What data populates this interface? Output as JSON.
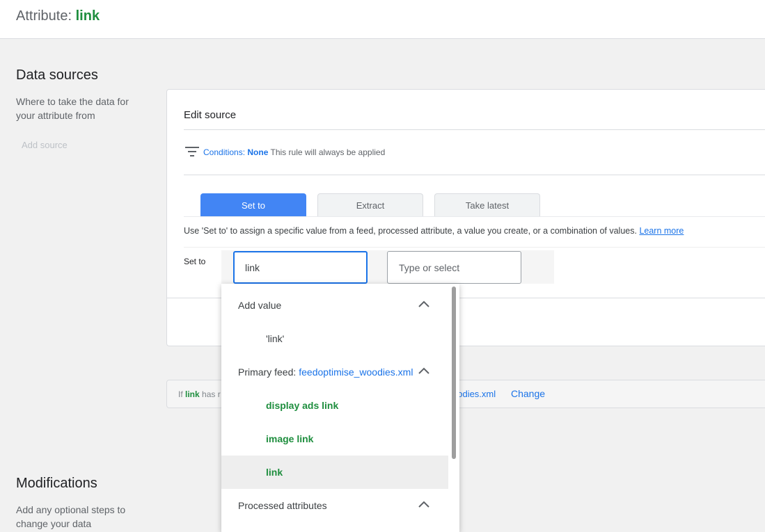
{
  "header": {
    "title_prefix": "Attribute:",
    "attr_name": "link"
  },
  "data_sources": {
    "title": "Data sources",
    "description": "Where to take the data for your attribute from",
    "add_source": "Add source"
  },
  "edit_source": {
    "title": "Edit source",
    "conditions_label": "Conditions:",
    "conditions_value": "None",
    "conditions_note": "This rule will always be applied",
    "tabs": [
      {
        "label": "Set to",
        "active": true
      },
      {
        "label": "Extract",
        "active": false
      },
      {
        "label": "Take latest",
        "active": false
      }
    ],
    "help_text": "Use 'Set to' to assign a specific value from a feed, processed attribute, a value you create, or a combination of values.",
    "learn_more": "Learn more",
    "set_to_label": "Set to",
    "input_value": "link",
    "input_placeholder": "Type or select"
  },
  "info_bar": {
    "prefix_if": "If",
    "attr": "link",
    "prefix_rest": "has r",
    "file_partial": "oodies.xml",
    "change": "Change"
  },
  "dropdown": {
    "add_value_group": "Add value",
    "add_value_item": "'link'",
    "primary_feed_label": "Primary feed:",
    "primary_feed_file": "feedoptimise_woodies.xml",
    "feed_items": [
      "display ads link",
      "image link",
      "link"
    ],
    "selected_item": "link",
    "processed_group": "Processed attributes"
  },
  "modifications": {
    "title": "Modifications",
    "description": "Add any optional steps to change your data"
  },
  "colors": {
    "accent_blue": "#1a73e8",
    "tab_active": "#4285f4",
    "green": "#1e8e3e"
  }
}
